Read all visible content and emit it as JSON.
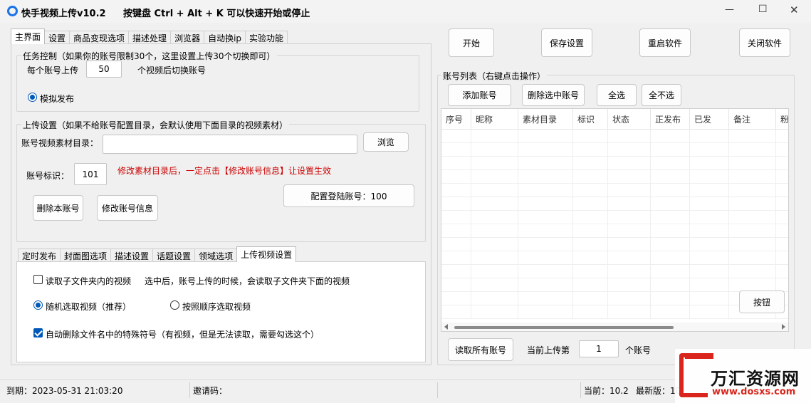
{
  "window": {
    "title": "快手视频上传v10.2",
    "hotkey_hint": "按键盘 Ctrl + Alt + K 可以快速开始或停止",
    "controls": {
      "minimize": "—",
      "maximize": "☐",
      "close": "✕"
    }
  },
  "main_tabs": [
    "主界面",
    "设置",
    "商品变现选项",
    "描述处理",
    "浏览器",
    "自动换ip",
    "实验功能"
  ],
  "task_control": {
    "title": "任务控制（如果你的账号限制30个，这里设置上传30个切换即可）",
    "per_account_label": "每个账号上传",
    "per_account_value": "50",
    "switch_suffix": "个视频后切换账号",
    "simulate_label": "模拟发布"
  },
  "upload_settings": {
    "title": "上传设置（如果不给账号配置目录，会默认使用下面目录的视频素材）",
    "dir_label": "账号视频素材目录：",
    "dir_value": "",
    "browse_btn": "浏览",
    "account_id_label": "账号标识：",
    "account_id_value": "101",
    "warning": "修改素材目录后，一定点击【修改账号信息】让设置生效",
    "config_login_btn": "配置登陆账号：100",
    "delete_btn": "删除本账号",
    "modify_btn": "修改账号信息"
  },
  "sub_tabs": [
    "定时发布",
    "封面图选项",
    "描述设置",
    "话题设置",
    "领域选项",
    "上传视频设置"
  ],
  "upload_video_settings": {
    "read_sub_label": "读取子文件夹内的视频",
    "read_sub_hint": "选中后，账号上传的时候，会读取子文件夹下面的视频",
    "random_label": "随机选取视频（推荐）",
    "sequential_label": "按照顺序选取视频",
    "auto_delete_label": "自动删除文件名中的特殊符号（有视频，但是无法读取，需要勾选这个）"
  },
  "top_buttons": {
    "start": "开始",
    "save": "保存设置",
    "restart": "重启软件",
    "close": "关闭软件"
  },
  "account_list": {
    "title": "账号列表（右键点击操作）",
    "add_btn": "添加账号",
    "delete_selected_btn": "删除选中账号",
    "select_all_btn": "全选",
    "select_none_btn": "全不选",
    "columns": [
      "序号",
      "昵称",
      "素材目录",
      "标识",
      "状态",
      "正发布",
      "已发",
      "备注",
      "粉"
    ],
    "rows": [],
    "button_label": "按钮",
    "read_all_btn": "读取所有账号",
    "current_label": "当前上传第",
    "current_value": "1",
    "current_suffix": "个账号"
  },
  "status_bar": {
    "expiry": "到期：2023-05-31 21:03:20",
    "invite": "邀请码：",
    "current_version": "当前：10.2",
    "latest_version": "最新版：10"
  },
  "watermark": {
    "brand": "万汇资源网",
    "url": "www.dosxs.com"
  },
  "colors": {
    "accent": "#0058b8",
    "warning": "#cc0000",
    "watermark_red": "#d9251c"
  }
}
